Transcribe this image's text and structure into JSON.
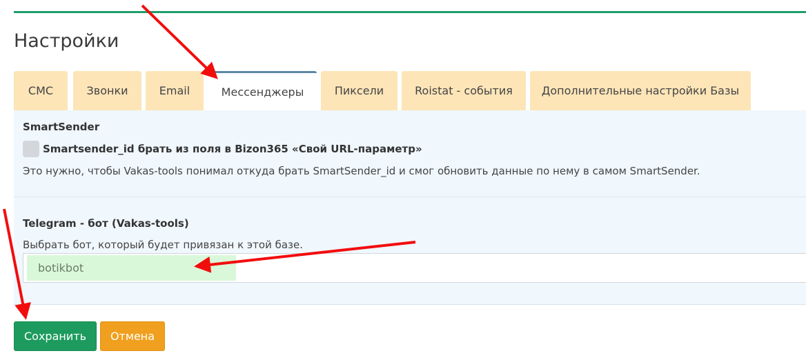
{
  "page": {
    "title": "Настройки"
  },
  "tabs": [
    {
      "label": "СМС",
      "active": false
    },
    {
      "label": "Звонки",
      "active": false
    },
    {
      "label": "Email",
      "active": false
    },
    {
      "label": "Мессенджеры",
      "active": true
    },
    {
      "label": "Пиксели",
      "active": false
    },
    {
      "label": "Roistat - события",
      "active": false
    },
    {
      "label": "Дополнительные настройки Базы",
      "active": false
    }
  ],
  "smartsender": {
    "title": "SmartSender",
    "checkbox_label": "Smartsender_id брать из поля в Bizon365 «Свой URL-параметр»",
    "checkbox_checked": false,
    "help": "Это нужно, чтобы Vakas-tools понимал откуда брать SmartSender_id и смог обновить данные по нему в самом SmartSender."
  },
  "telegram": {
    "title": "Telegram - бот (Vakas-tools)",
    "help": "Выбрать бот, который будет привязан к этой базе.",
    "selected_bot": "botikbot"
  },
  "actions": {
    "save_label": "Сохранить",
    "cancel_label": "Отмена"
  },
  "colors": {
    "accent_green": "#1d9b5e",
    "cancel_orange": "#f0a01e",
    "tab_bg": "#fde5b8",
    "annotation_arrow": "#f20d0d"
  }
}
